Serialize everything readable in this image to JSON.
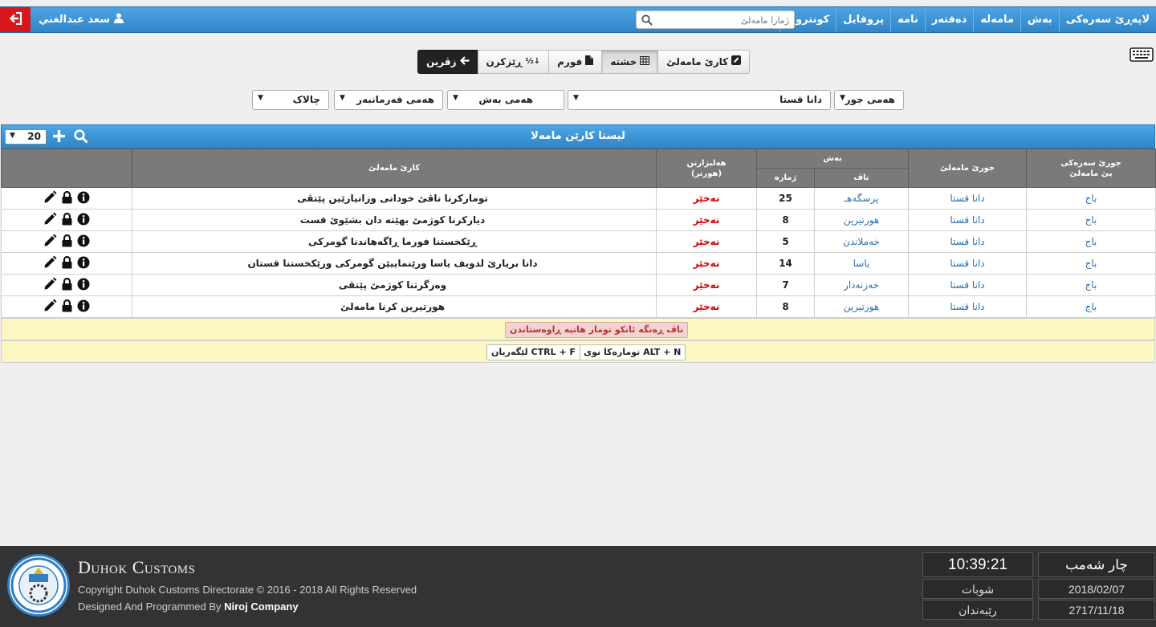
{
  "colors": {
    "accent": "#2f86c8",
    "danger": "#d9171b",
    "link": "#2a6fb0",
    "status_red": "#d60000",
    "info_row": "#fdf8c2"
  },
  "nav": {
    "items": [
      "لاپەڕێ سەرەکی",
      "بەش",
      "مامەلە",
      "دەفتەر",
      "نامە",
      "پروفایل",
      "کونترول"
    ],
    "search_placeholder": "ژمارا مامەلێ",
    "user_name": "سعد عبدالغني"
  },
  "view_buttons": {
    "back": "زڤرین",
    "sort": "ڕێزکرن",
    "form": "فورم",
    "table": "خشتە",
    "transaction": "کارێ مامەلێ"
  },
  "filters": {
    "type": "هەمی جور",
    "subject": "دانا قستا",
    "section": "هەمی بەش",
    "employee": "هەمی فەرمانبەر",
    "status": "چالاک"
  },
  "panel": {
    "title": "ليستا كارێن مامەلا",
    "page_size": "20"
  },
  "table": {
    "headers": {
      "main_type": "جورێ سەرەکی",
      "main_type_line2": "یێ مامەلێ",
      "txn_type": "جورێ مامەلێ",
      "section": "بەش",
      "name": "ناڤ",
      "number": "ژمارە",
      "selected": "هەلبژارتن",
      "selected_line2": "(هورتر)",
      "transaction": "کارێ مامەلێ"
    },
    "rows": [
      {
        "main": "باج",
        "type": "دانا قستا",
        "section": "پرسگەهـ",
        "num": "25",
        "status": "نەخێر",
        "subject": "تومارکرنا ناڤێ خودانی وزانیارێین پێتڤی"
      },
      {
        "main": "باج",
        "type": "دانا قستا",
        "section": "هورتیرین",
        "num": "8",
        "status": "نەخێر",
        "subject": "دیارکرنا کوژمێ بهێتە دان بشێوێ قست"
      },
      {
        "main": "باج",
        "type": "دانا قستا",
        "section": "خەملاندن",
        "num": "5",
        "status": "نەخێر",
        "subject": "ڕێکخستنا فورما ڕاگەهاندنا گومرکی"
      },
      {
        "main": "باج",
        "type": "دانا قستا",
        "section": "یاسا",
        "num": "14",
        "status": "نەخێر",
        "subject": "دانا بریارێ لدویف یاسا ورێنماییێن گومرکی ورێکخستنا قستان"
      },
      {
        "main": "باج",
        "type": "دانا قستا",
        "section": "خەزنەدار",
        "num": "7",
        "status": "نەخێر",
        "subject": "وەرگرتنا کوژمێ پێتڤی"
      },
      {
        "main": "باج",
        "type": "دانا قستا",
        "section": "هورتیرین",
        "num": "8",
        "status": "نەخێر",
        "subject": "هورتیرین کرنا مامەلێ"
      }
    ]
  },
  "notes": {
    "legend": "ناڤ ڕەنگە ئانکو تومار هاتیە ڕاوەستاندن",
    "shortcut_new": "ALT + N تومارەکا نوی",
    "shortcut_find": "CTRL + F لێگەریان"
  },
  "footer": {
    "brand": "Duhok Customs",
    "copyright": "Copyright Duhok Customs Directorate © 2016 - 2018 All Rights Reserved",
    "designed_prefix": "Designed And Programmed By",
    "designed_company": "Niroj Company",
    "time": "10:39:21",
    "day": "چار شەمب",
    "month_ar": "شوبات",
    "date_greg": "2018/02/07",
    "month_ku": "رێبەندان",
    "date_ku": "2717/11/18"
  }
}
